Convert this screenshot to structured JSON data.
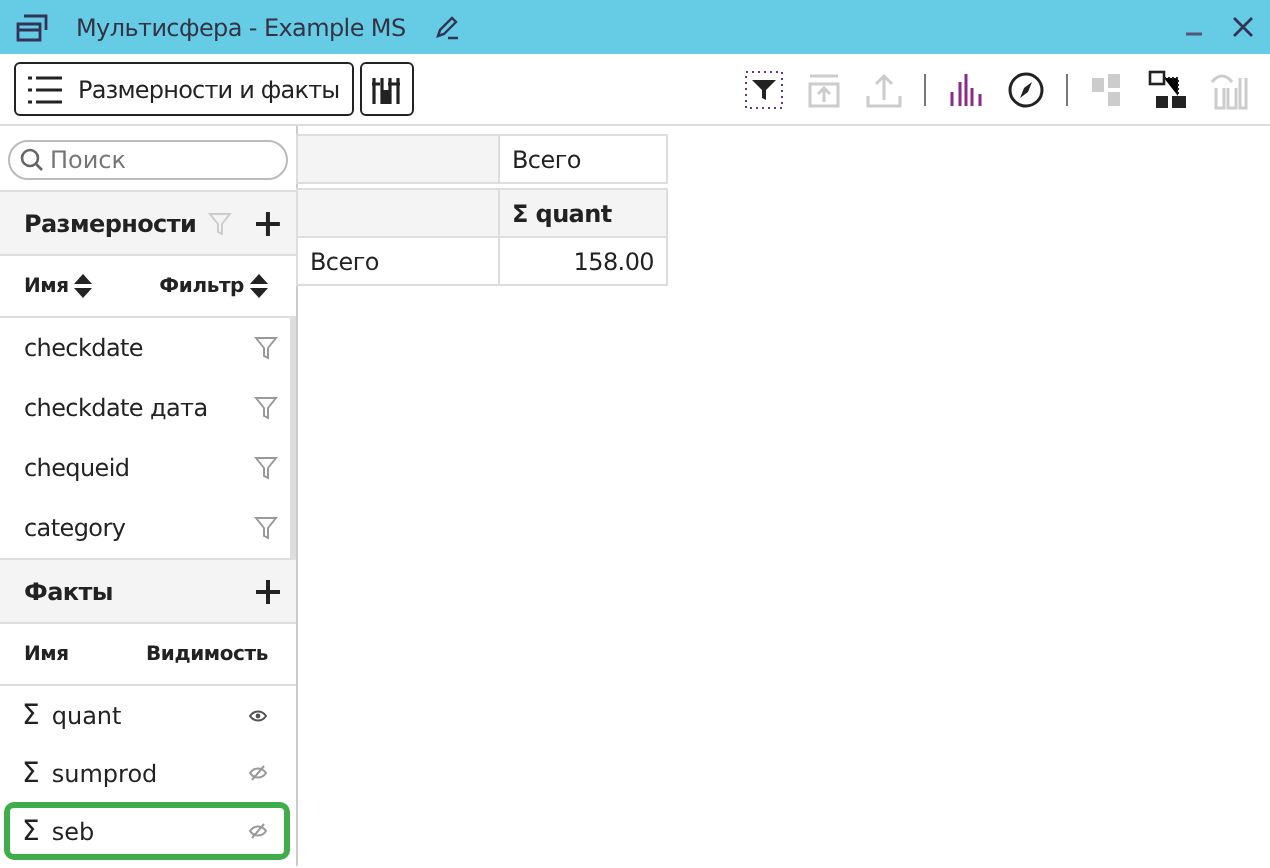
{
  "window": {
    "title": "Мультисфера - Example MS"
  },
  "toolbar": {
    "panel_button": "Размерности и факты",
    "tools": [
      {
        "kind": "filter",
        "disabled": false
      },
      {
        "kind": "export",
        "disabled": true
      },
      {
        "kind": "upload",
        "disabled": true
      },
      {
        "kind": "sep"
      },
      {
        "kind": "chart",
        "disabled": false
      },
      {
        "kind": "compass",
        "disabled": false
      },
      {
        "kind": "sep"
      },
      {
        "kind": "copy",
        "disabled": true
      },
      {
        "kind": "tree",
        "disabled": false
      },
      {
        "kind": "hide",
        "disabled": true
      }
    ]
  },
  "search": {
    "placeholder": "Поиск"
  },
  "dimensions": {
    "title": "Размерности",
    "columns": [
      "Имя",
      "Фильтр"
    ],
    "items": [
      {
        "name": "checkdate"
      },
      {
        "name": "checkdate дата"
      },
      {
        "name": "chequeid"
      },
      {
        "name": "category"
      }
    ]
  },
  "facts": {
    "title": "Факты",
    "columns": [
      "Имя",
      "Видимость"
    ],
    "items": [
      {
        "sigma": "Σ",
        "name": "quant",
        "visible": true,
        "selected": false
      },
      {
        "sigma": "Σ",
        "name": "sumprod",
        "visible": false,
        "selected": false
      },
      {
        "sigma": "Σ",
        "name": "seb",
        "visible": false,
        "selected": true
      }
    ]
  },
  "table": {
    "column_header": "Всего",
    "measure": "Σ quant",
    "rows": [
      {
        "label": "Всего",
        "value": "158.00"
      }
    ]
  }
}
